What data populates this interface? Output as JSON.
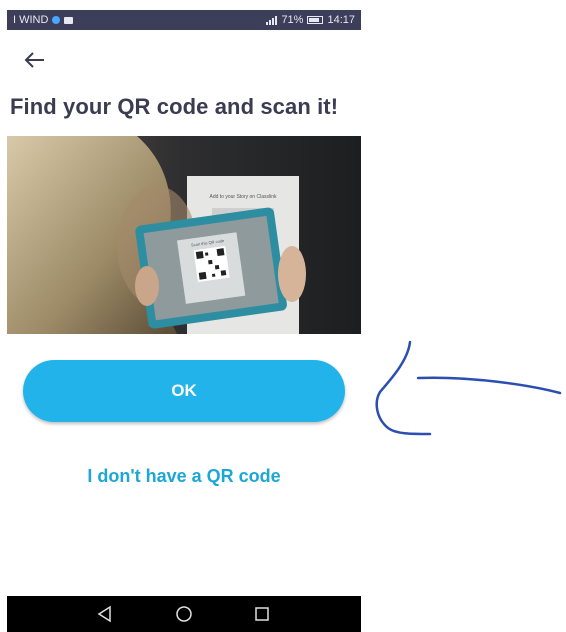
{
  "statusbar": {
    "carrier": "I WIND",
    "battery_level": "71%",
    "time": "14:17"
  },
  "header": {
    "back_icon": "arrow-left-icon",
    "title": "Find your QR code and scan it!"
  },
  "photo": {
    "sign_text": "Add to your Story on Classlink",
    "qr_card_text": "Scan this QR code"
  },
  "actions": {
    "ok_label": "OK",
    "no_qr_label": "I don't have a QR code"
  },
  "navbar": {
    "back_icon": "triangle-back-icon",
    "home_icon": "circle-home-icon",
    "recents_icon": "square-recents-icon"
  },
  "colors": {
    "accent": "#21b3ea",
    "link": "#1ca7d8",
    "title": "#3b3b52",
    "statusbar": "#3c3e5a",
    "annotation": "#2a4fb0"
  }
}
